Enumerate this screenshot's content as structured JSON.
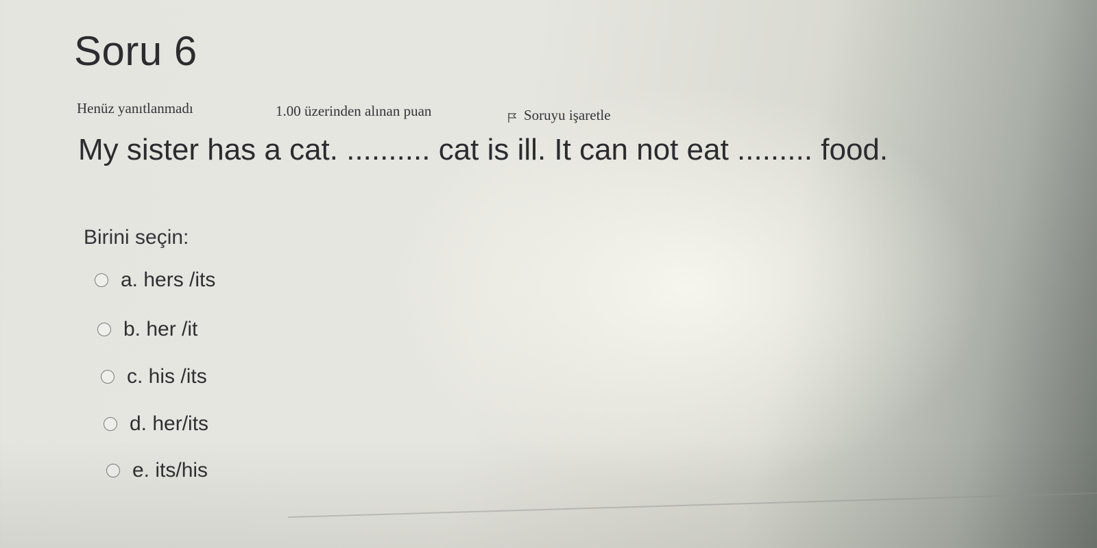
{
  "question": {
    "title": "Soru 6",
    "status": "Henüz yanıtlanmadı",
    "points": "1.00 üzerinden alınan puan",
    "flag_label": "Soruyu işaretle",
    "flag_icon": "flag-icon",
    "text": "My sister has a cat. .......... cat is ill. It can not eat ......... food."
  },
  "answer": {
    "prompt": "Birini seçin:",
    "options": [
      {
        "label": "a. hers /its",
        "selected": false
      },
      {
        "label": "b. her /it",
        "selected": false
      },
      {
        "label": "c. his /its",
        "selected": false
      },
      {
        "label": "d. her/its",
        "selected": false
      },
      {
        "label": "e. its/his",
        "selected": false
      }
    ]
  }
}
